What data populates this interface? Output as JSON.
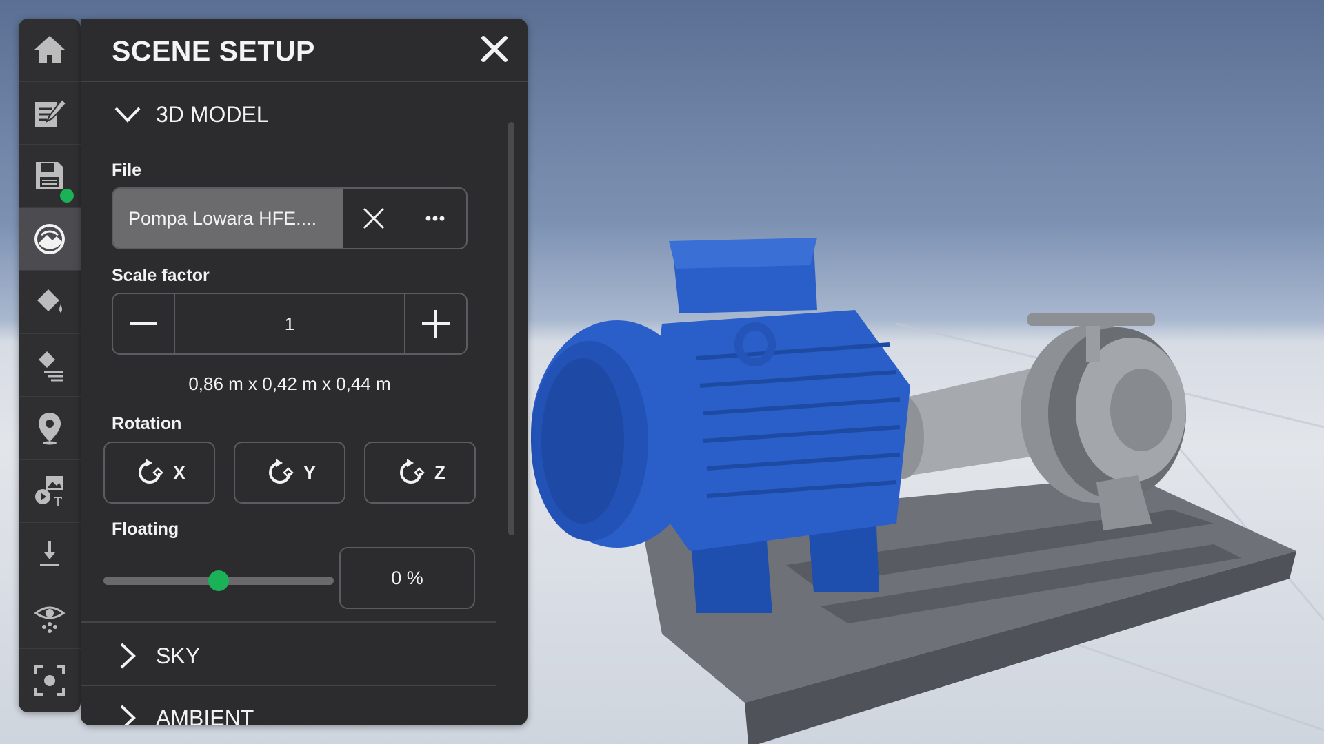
{
  "toolbar": {
    "items": [
      {
        "icon": "home-icon"
      },
      {
        "icon": "edit-icon"
      },
      {
        "icon": "save-icon",
        "status": "saved"
      },
      {
        "icon": "scene-setup-icon",
        "active": true
      },
      {
        "icon": "paint-bucket-icon"
      },
      {
        "icon": "fill-layers-icon"
      },
      {
        "icon": "location-pin-icon"
      },
      {
        "icon": "media-icon"
      },
      {
        "icon": "download-icon"
      },
      {
        "icon": "visibility-icon"
      },
      {
        "icon": "focus-icon"
      }
    ],
    "active_color": "#4c4c50",
    "status_color": "#1ab157"
  },
  "panel": {
    "title": "SCENE SETUP",
    "sections": {
      "model": {
        "label": "3D MODEL",
        "expanded": true
      },
      "sky": {
        "label": "SKY",
        "expanded": false
      },
      "ambient": {
        "label": "AMBIENT",
        "expanded": false
      }
    },
    "file": {
      "label": "File",
      "value": "Pompa Lowara HFE...."
    },
    "scale": {
      "label": "Scale factor",
      "value": "1",
      "dimensions": "0,86 m x 0,42 m x 0,44 m"
    },
    "rotation": {
      "label": "Rotation",
      "axes": [
        "X",
        "Y",
        "Z"
      ]
    },
    "floating": {
      "label": "Floating",
      "value": 0,
      "value_text": "0 %"
    }
  },
  "colors": {
    "accent": "#1ab157",
    "panel_bg": "#2c2c2e",
    "toolbar_bg": "#2f2f31"
  }
}
